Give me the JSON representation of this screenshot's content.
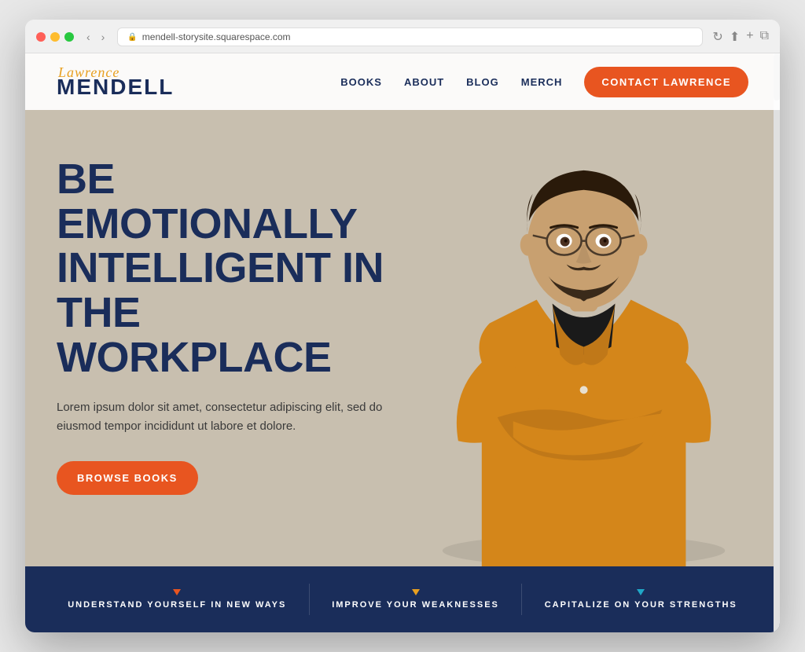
{
  "browser": {
    "url": "mendell-storysite.squarespace.com",
    "reload_label": "↻"
  },
  "nav": {
    "logo_script": "Lawrence",
    "logo_main": "MENDELL",
    "links": [
      {
        "label": "BOOKS",
        "id": "books"
      },
      {
        "label": "ABOUT",
        "id": "about"
      },
      {
        "label": "BLOG",
        "id": "blog"
      },
      {
        "label": "MERCH",
        "id": "merch"
      }
    ],
    "contact_button": "CONTACT LAWRENCE"
  },
  "hero": {
    "title": "BE EMOTIONALLY INTELLIGENT IN THE WORKPLACE",
    "body": "Lorem ipsum dolor sit amet, consectetur adipiscing elit, sed do eiusmod tempor incididunt ut labore et dolore.",
    "cta": "BROWSE BOOKS"
  },
  "bottom_bar": {
    "items": [
      {
        "label": "UNDERSTAND YOURSELF IN NEW WAYS",
        "dot_color": "orange"
      },
      {
        "label": "IMPROVE YOUR WEAKNESSES",
        "dot_color": "yellow"
      },
      {
        "label": "CAPITALIZE ON YOUR STRENGTHS",
        "dot_color": "teal"
      }
    ]
  },
  "colors": {
    "navy": "#1a2d5a",
    "orange": "#e85520",
    "gold": "#e8a020",
    "teal": "#20a8c8",
    "bg_hero": "#c8bfaf"
  }
}
